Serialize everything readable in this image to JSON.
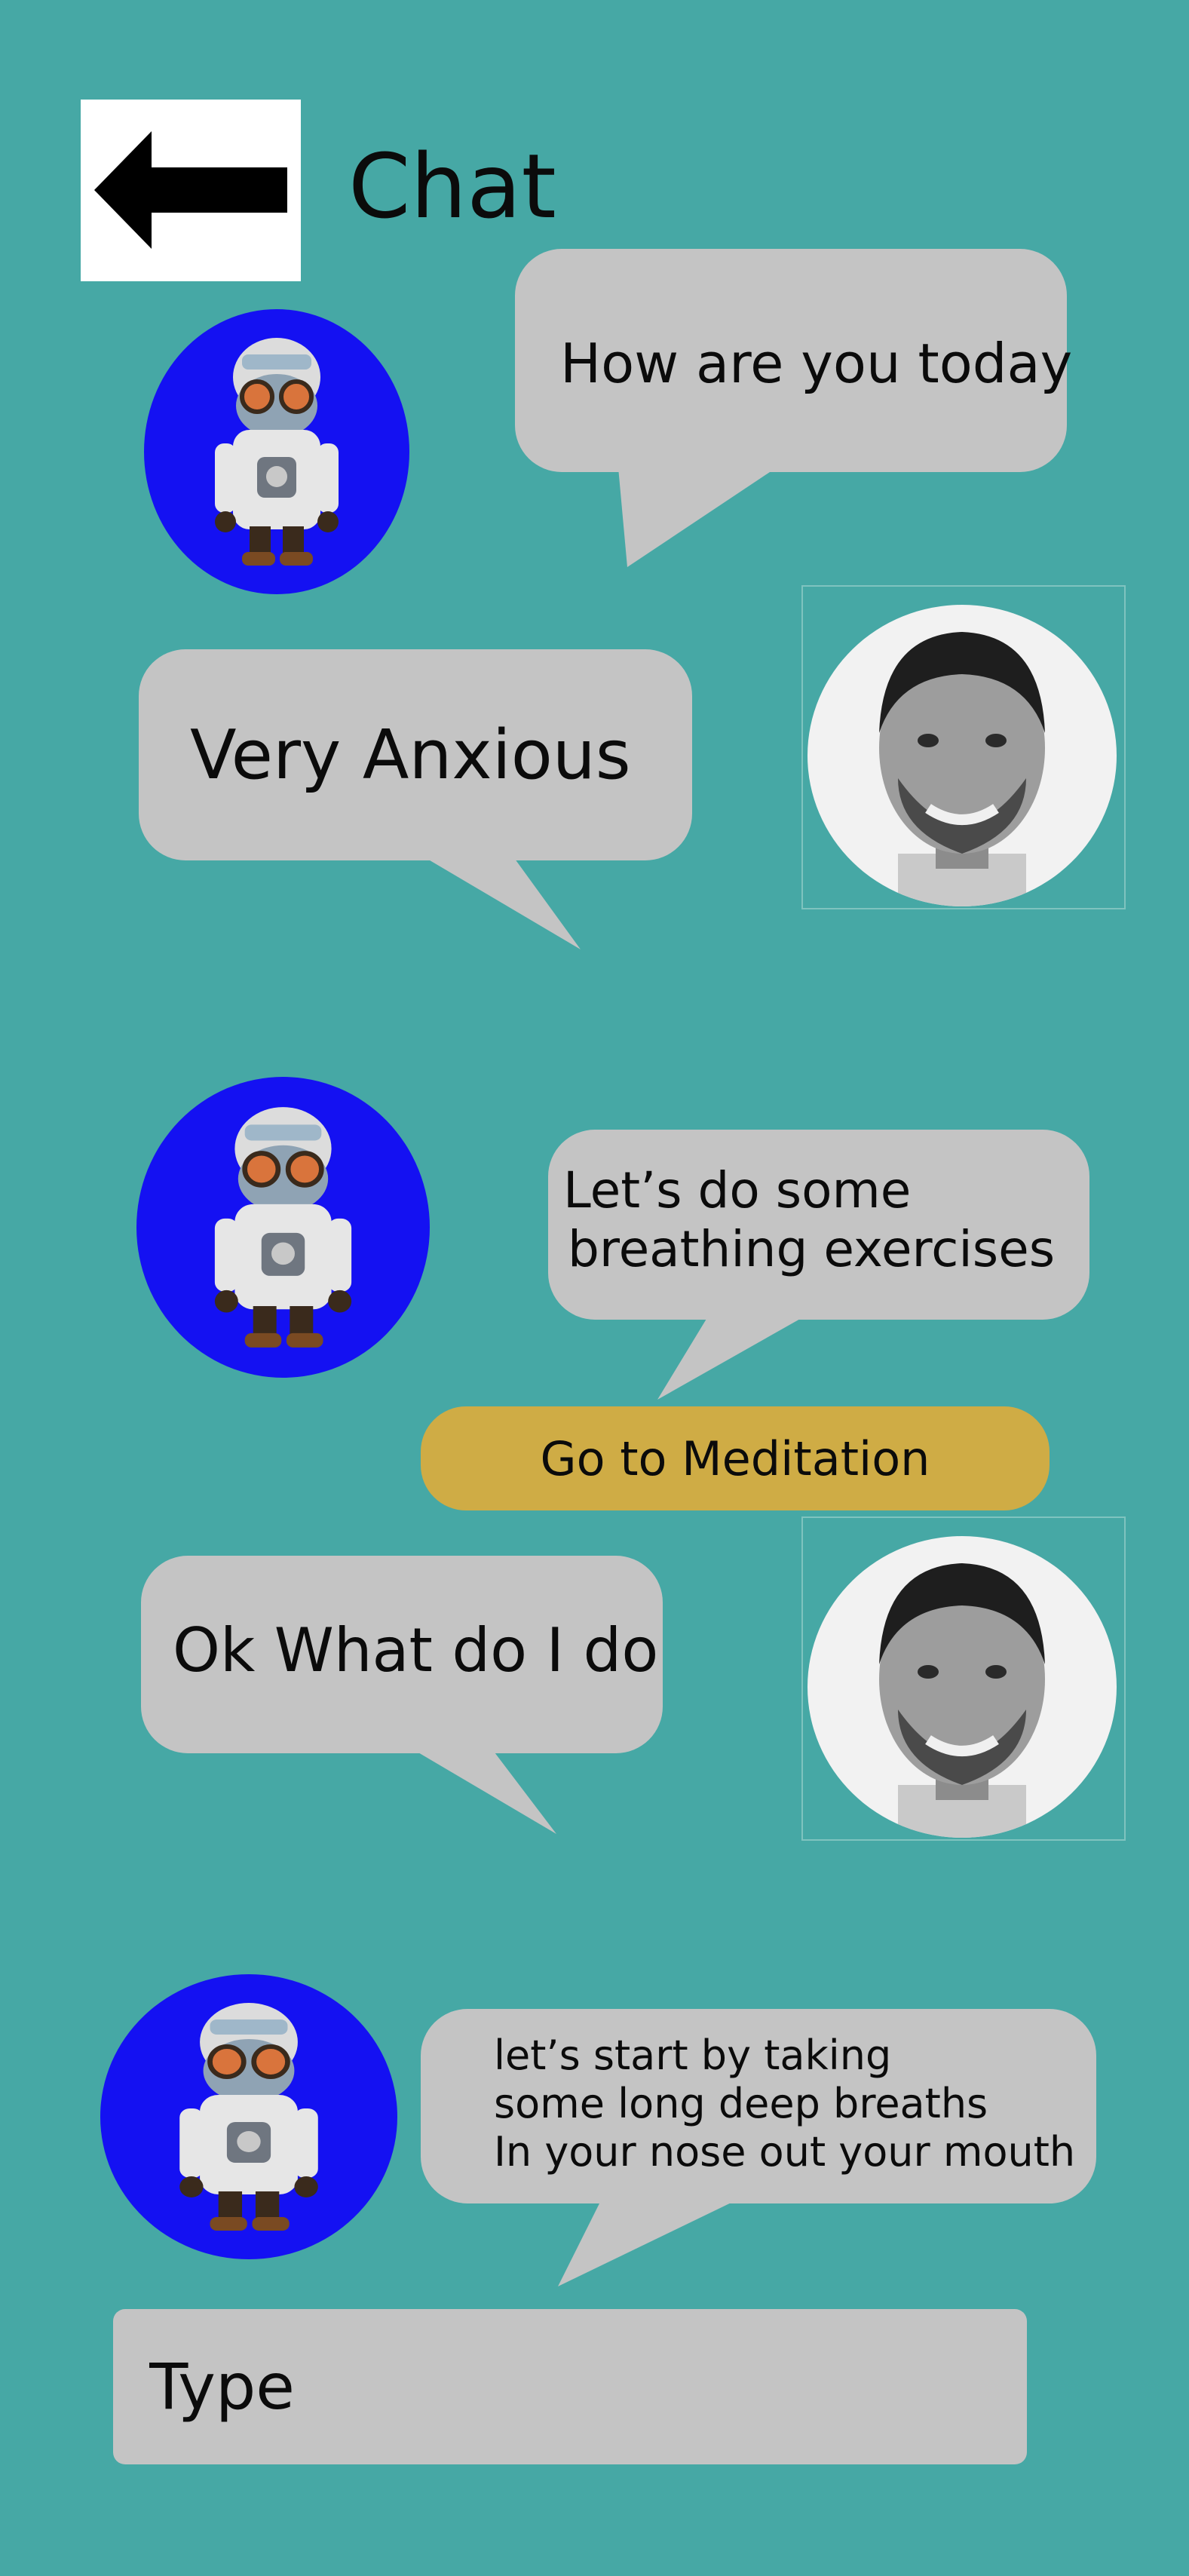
{
  "header": {
    "back_icon": "arrow-left-icon",
    "title": "Chat"
  },
  "messages": [
    {
      "sender": "bot",
      "text": "How are you today"
    },
    {
      "sender": "user",
      "text": "Very Anxious"
    },
    {
      "sender": "bot",
      "lines": [
        "Let’s do some",
        "breathing exercises"
      ]
    },
    {
      "sender": "user",
      "text": "Ok What do I do"
    },
    {
      "sender": "bot",
      "lines": [
        "let’s start by taking",
        "some long deep breaths",
        "In your nose out your mouth"
      ]
    }
  ],
  "meditation_button": {
    "label": "Go to Meditation"
  },
  "composer": {
    "placeholder": "Type"
  },
  "colors": {
    "background": "#46a8a5",
    "bubble": "#c4c4c4",
    "bot_avatar_bg": "#1411f2",
    "meditation_button": "#cfac45",
    "back_button_bg": "#ffffff"
  }
}
